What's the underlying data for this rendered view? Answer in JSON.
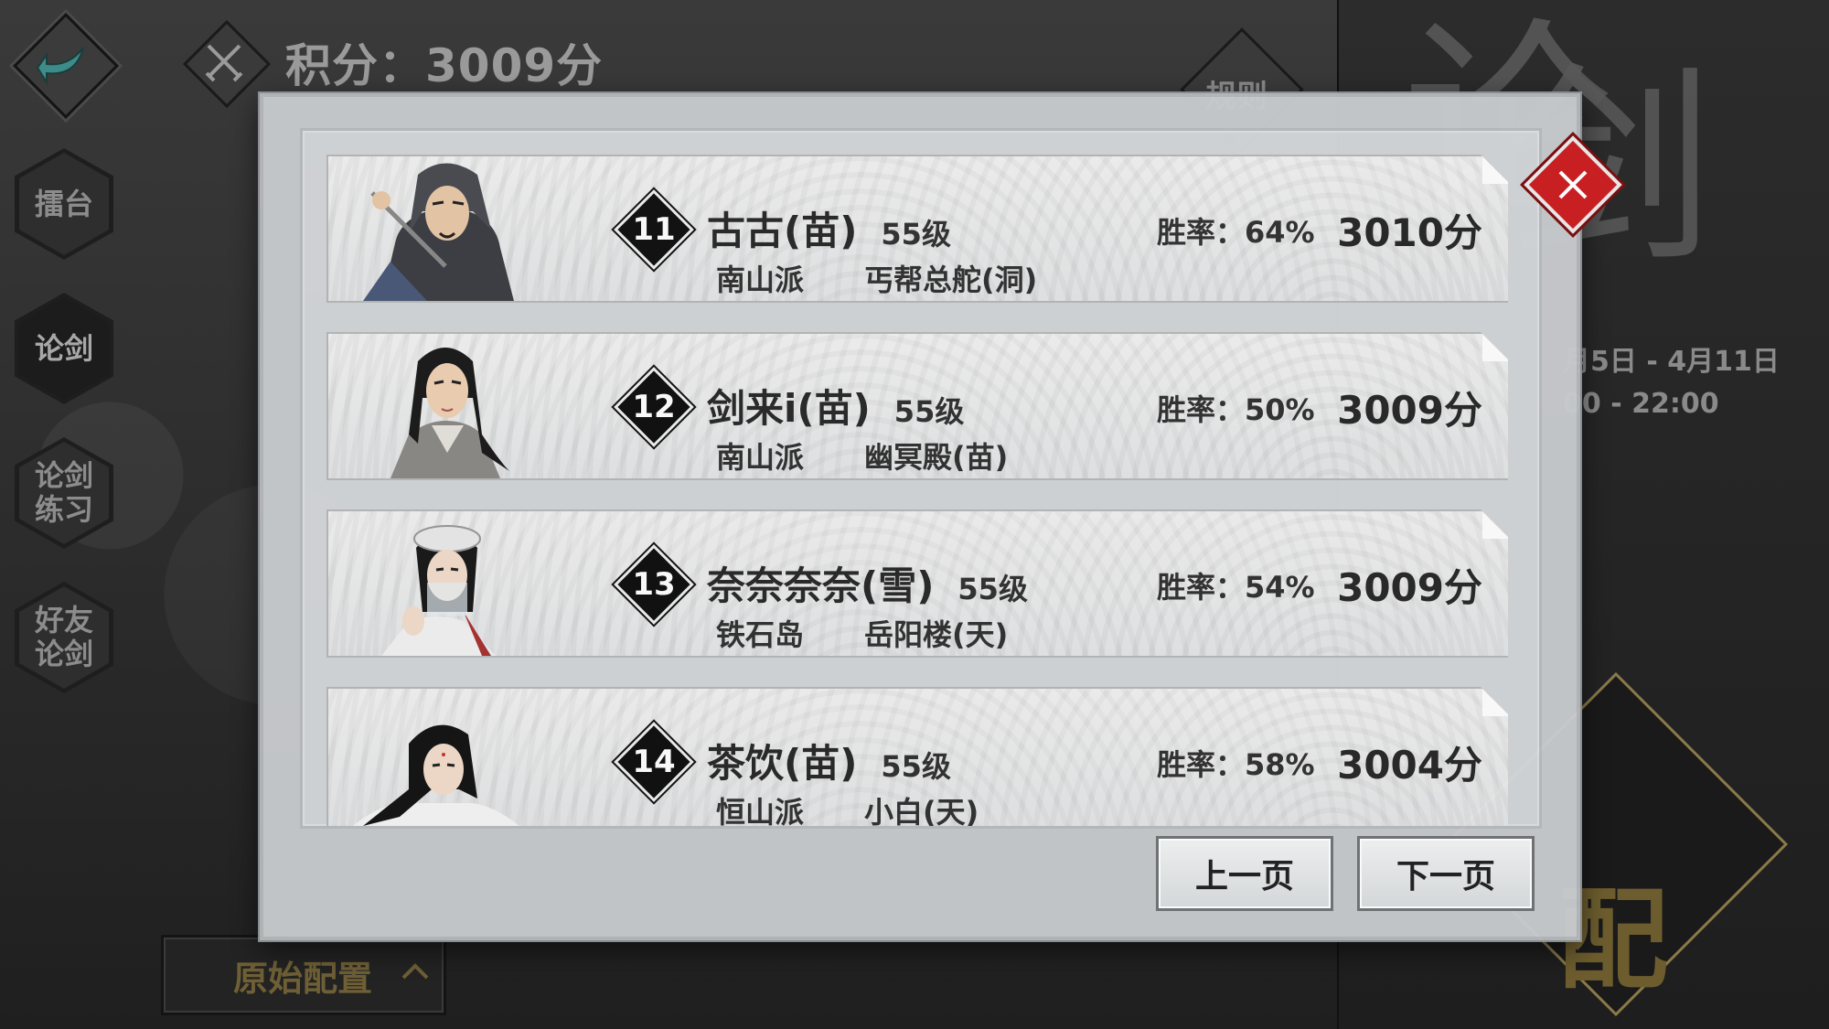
{
  "header": {
    "score_text": "积分：3009分",
    "rules_label": "规则"
  },
  "nav": [
    {
      "label": "擂台",
      "active": false
    },
    {
      "label": "论剑",
      "active": true
    },
    {
      "label": "论剑\n练习",
      "active": false
    },
    {
      "label": "好友\n论剑",
      "active": false
    }
  ],
  "right_panel": {
    "date_range": "月5日 - 4月11日",
    "time_range": "00 - 22:00"
  },
  "config_button": {
    "label": "原始配置"
  },
  "ranking": [
    {
      "rank": "11",
      "name": "古古(苗)",
      "level": "55级",
      "school": "南山派",
      "master": "丐帮总舵(洞)",
      "winrate": "胜率：64%",
      "points": "3010分",
      "portrait": "hooded-swordsman"
    },
    {
      "rank": "12",
      "name": "剑来i(苗)",
      "level": "55级",
      "school": "南山派",
      "master": "幽冥殿(苗)",
      "winrate": "胜率：50%",
      "points": "3009分",
      "portrait": "long-hair-man"
    },
    {
      "rank": "13",
      "name": "奈奈奈奈(雪)",
      "level": "55级",
      "school": "铁石岛",
      "master": "岳阳楼(天)",
      "winrate": "胜率：54%",
      "points": "3009分",
      "portrait": "veiled-woman"
    },
    {
      "rank": "14",
      "name": "茶饮(苗)",
      "level": "55级",
      "school": "恒山派",
      "master": "小白(天)",
      "winrate": "胜率：58%",
      "points": "3004分",
      "portrait": "young-woman"
    }
  ],
  "pagination": {
    "prev_label": "上一页",
    "next_label": "下一页"
  },
  "colors": {
    "close_red": "#c81f23",
    "gold": "#6e5f35"
  }
}
